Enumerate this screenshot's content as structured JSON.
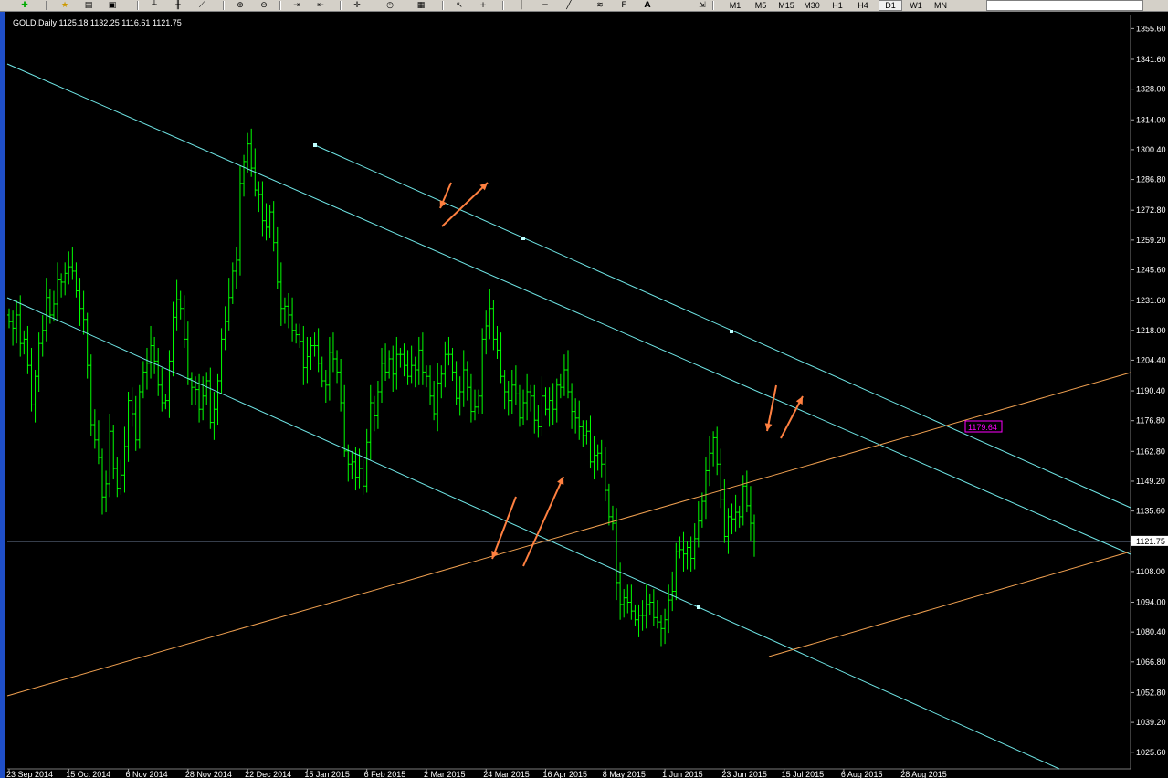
{
  "toolbar": {
    "icons": [
      "new-order-icon",
      "favorites-icon",
      "templates-icon",
      "profiles-icon",
      "bar-chart-icon",
      "candles-icon",
      "line-chart-icon",
      "zoom-in-icon",
      "zoom-out-icon",
      "chart-shift-icon",
      "autoscroll-icon",
      "indicators-icon",
      "periods-icon",
      "templates-dropdown-icon",
      "cursor-icon",
      "crosshair-icon",
      "vertical-line-icon",
      "horizontal-line-icon",
      "trendline-icon",
      "channel-icon",
      "fibonacci-icon",
      "text-icon",
      "arrows-icon"
    ],
    "text_tool": "A",
    "timeframes": [
      "M1",
      "M5",
      "M15",
      "M30",
      "H1",
      "H4",
      "D1",
      "W1",
      "MN"
    ],
    "active_timeframe": "D1"
  },
  "chart": {
    "header": "GOLD,Daily  1125.18 1132.25 1116.61 1121.75",
    "current_price_label": "1121.75",
    "intersection_label": "1179.64",
    "colors": {
      "background": "#000000",
      "bars": "#00ff00",
      "channel": "#6fe6e6",
      "support": "#f0a050",
      "arrows": "#ff8040",
      "price_line": "#8fa6c8",
      "label_box": "#ff00ff"
    }
  },
  "chart_data": {
    "type": "bar",
    "title": "GOLD,Daily",
    "ohlc_last": {
      "open": 1125.18,
      "high": 1132.25,
      "low": 1116.61,
      "close": 1121.75
    },
    "ylim": [
      1018,
      1362
    ],
    "y_ticks": [
      1355.6,
      1341.6,
      1328.0,
      1314.0,
      1300.4,
      1286.8,
      1272.8,
      1259.2,
      1245.6,
      1231.6,
      1218.0,
      1204.4,
      1190.4,
      1176.8,
      1162.8,
      1149.2,
      1135.6,
      1121.75,
      1108.0,
      1094.0,
      1080.4,
      1066.8,
      1052.8,
      1039.2,
      1025.6
    ],
    "y_tick_labels": [
      "1355.60",
      "1341.60",
      "1328.00",
      "1314.00",
      "1300.40",
      "1286.80",
      "1272.80",
      "1259.20",
      "1245.60",
      "1231.60",
      "1218.00",
      "1204.40",
      "1190.40",
      "1176.80",
      "1162.80",
      "1149.20",
      "1135.60",
      "1121.75",
      "1108.00",
      "1094.00",
      "1080.40",
      "1066.80",
      "1052.80",
      "1039.20",
      "1025.60"
    ],
    "x_tick_labels": [
      "23 Sep 2014",
      "15 Oct 2014",
      "6 Nov 2014",
      "28 Nov 2014",
      "22 Dec 2014",
      "15 Jan 2015",
      "6 Feb 2015",
      "2 Mar 2015",
      "24 Mar 2015",
      "16 Apr 2015",
      "8 May 2015",
      "1 Jun 2015",
      "23 Jun 2015",
      "15 Jul 2015",
      "6 Aug 2015",
      "28 Aug 2015"
    ],
    "x_tick_bar_index": [
      0,
      16,
      32,
      48,
      64,
      80,
      96,
      112,
      128,
      144,
      160,
      176,
      192,
      208,
      224,
      240
    ],
    "closes": [
      1222,
      1219,
      1225,
      1212,
      1214,
      1202,
      1184,
      1197,
      1212,
      1218,
      1233,
      1225,
      1230,
      1241,
      1240,
      1244,
      1247,
      1245,
      1236,
      1228,
      1223,
      1202,
      1175,
      1168,
      1160,
      1142,
      1148,
      1172,
      1155,
      1146,
      1152,
      1165,
      1186,
      1180,
      1168,
      1190,
      1199,
      1203,
      1211,
      1204,
      1193,
      1185,
      1186,
      1204,
      1224,
      1232,
      1228,
      1214,
      1196,
      1192,
      1191,
      1182,
      1188,
      1195,
      1176,
      1182,
      1195,
      1214,
      1222,
      1233,
      1245,
      1250,
      1285,
      1295,
      1303,
      1292,
      1282,
      1280,
      1268,
      1265,
      1272,
      1258,
      1240,
      1228,
      1229,
      1225,
      1218,
      1216,
      1213,
      1201,
      1206,
      1211,
      1211,
      1203,
      1195,
      1193,
      1208,
      1205,
      1199,
      1185,
      1163,
      1157,
      1158,
      1151,
      1155,
      1147,
      1167,
      1185,
      1179,
      1190,
      1203,
      1199,
      1205,
      1198,
      1207,
      1207,
      1202,
      1197,
      1202,
      1200,
      1209,
      1199,
      1197,
      1188,
      1180,
      1194,
      1198,
      1207,
      1207,
      1199,
      1187,
      1190,
      1200,
      1192,
      1181,
      1183,
      1188,
      1214,
      1220,
      1228,
      1214,
      1209,
      1197,
      1190,
      1186,
      1193,
      1189,
      1178,
      1185,
      1190,
      1188,
      1177,
      1174,
      1188,
      1182,
      1186,
      1182,
      1193,
      1192,
      1200,
      1190,
      1181,
      1178,
      1174,
      1170,
      1172,
      1158,
      1161,
      1162,
      1157,
      1145,
      1133,
      1130,
      1103,
      1093,
      1096,
      1094,
      1090,
      1086,
      1088,
      1088,
      1093,
      1094,
      1087,
      1085,
      1082,
      1086,
      1095,
      1099,
      1117,
      1118,
      1116,
      1119,
      1114,
      1123,
      1131,
      1140,
      1154,
      1162,
      1169,
      1157,
      1141,
      1124,
      1133,
      1132,
      1135,
      1133,
      1147,
      1138,
      1130,
      1121.75
    ]
  }
}
